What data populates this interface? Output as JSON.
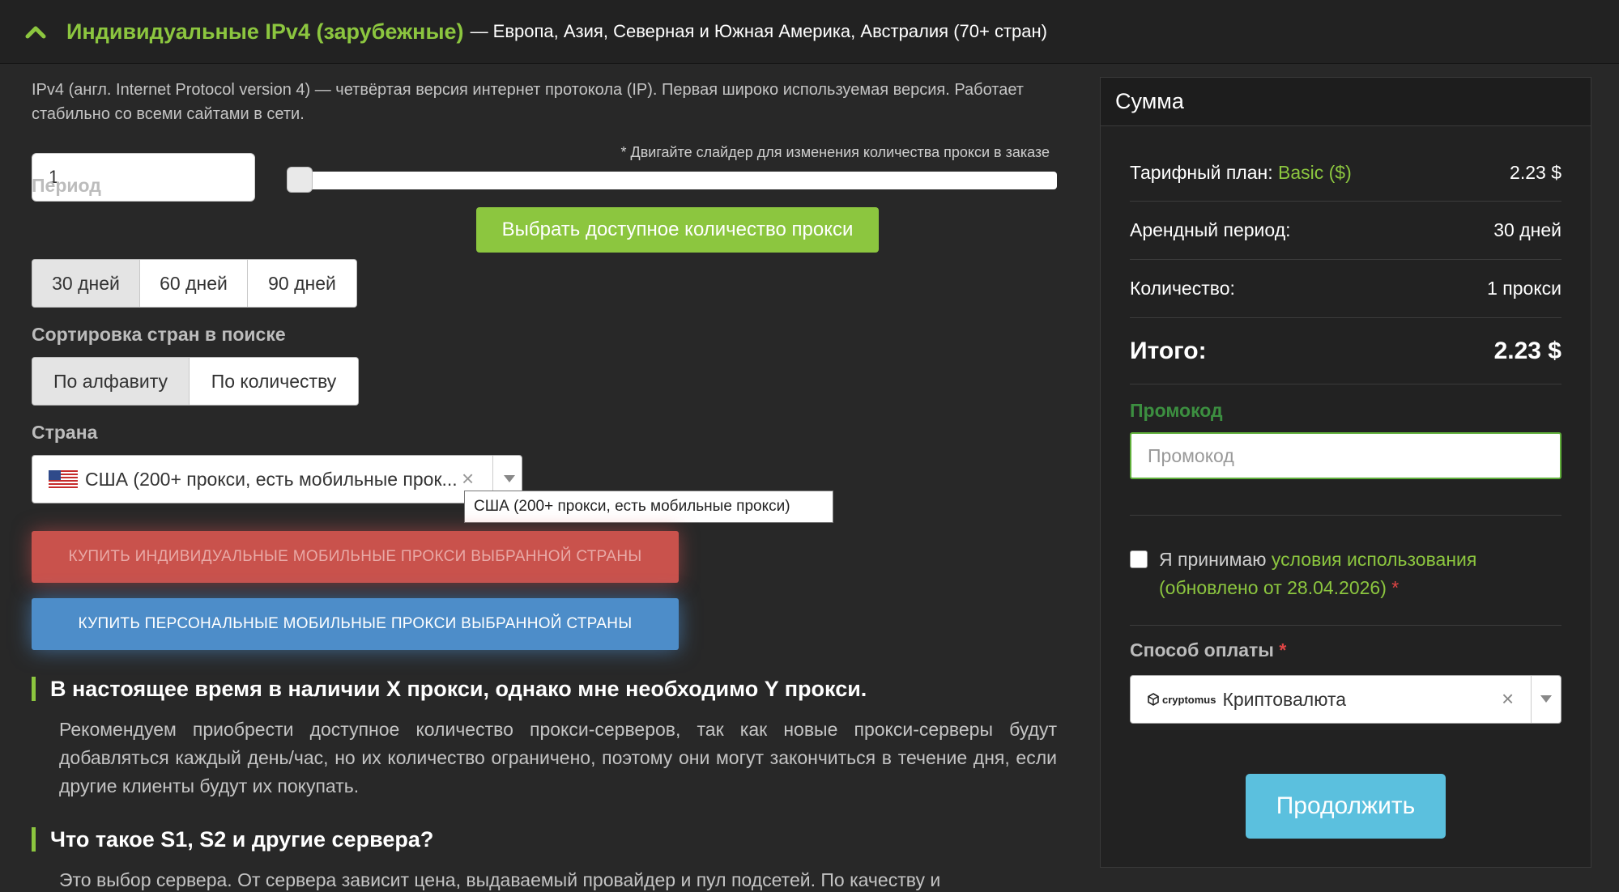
{
  "header": {
    "title": "Индивидуальные IPv4 (зарубежные)",
    "subtitle": "— Европа, Азия, Северная и Южная Америка, Австралия (70+ стран)",
    "collapse_icon": "chevron-up-icon"
  },
  "intro": {
    "text": "IPv4 (англ. Internet Protocol version 4) — четвёртая версия интернет протокола (IP). Первая широко используемая версия. Работает стабильно со всеми сайтами в сети."
  },
  "quantity": {
    "value": "1",
    "slider_hint": "* Двигайте слайдер для изменения количества прокси в заказе",
    "slider_level": 0,
    "available_button": "Выбрать доступное количество прокси"
  },
  "period": {
    "label": "Период",
    "options": [
      "30 дней",
      "60 дней",
      "90 дней"
    ],
    "selected": "30 дней"
  },
  "sort": {
    "label": "Сортировка стран в поиске",
    "options": [
      "По алфавиту",
      "По количеству"
    ],
    "selected": "По алфавиту"
  },
  "country": {
    "label": "Страна",
    "value": "США (200+ прокси, есть мобильные прок...",
    "tooltip": "США (200+ прокси, есть мобильные прокси)",
    "flag_icon": "us-flag-icon"
  },
  "buttons": {
    "buy_individual_mobile": "КУПИТЬ ИНДИВИДУАЛЬНЫЕ МОБИЛЬНЫЕ ПРОКСИ ВЫБРАННОЙ СТРАНЫ",
    "buy_personal_mobile": "КУПИТЬ ПЕРСОНАЛЬНЫЕ МОБИЛЬНЫЕ ПРОКСИ ВЫБРАННОЙ СТРАНЫ"
  },
  "faq": [
    {
      "question": "В настоящее время в наличии X прокси, однако мне необходимо Y прокси.",
      "answer": "Рекомендуем приобрести доступное количество прокси-серверов, так как новые прокси-серверы будут добавляться каждый день/час, но их количество ограничено, поэтому они могут закончиться в течение дня, если другие клиенты будут их покупать."
    },
    {
      "question": "Что такое S1, S2 и другие сервера?",
      "answer": "Это выбор сервера. От сервера зависит цена, выдаваемый провайдер и пул подсетей. По качеству и"
    }
  ],
  "summary": {
    "title": "Сумма",
    "plan_label": "Тарифный план:",
    "plan_name": "Basic ($)",
    "plan_price": "2.23 $",
    "period_label": "Арендный период:",
    "period_value": "30 дней",
    "quantity_label": "Количество:",
    "quantity_value": "1 прокси",
    "total_label": "Итого:",
    "total_value": "2.23 $",
    "promo_label": "Промокод",
    "promo_placeholder": "Промокод",
    "terms_prefix": "Я принимаю",
    "terms_link": "условия использования (обновлено от 28.04.2026)",
    "terms_required": "*",
    "payment_label": "Способ оплаты",
    "payment_required": "*",
    "payment_logo": "cryptomus",
    "payment_value": "Криптовалюта",
    "continue_button": "Продолжить"
  },
  "colors": {
    "accent_green": "#8cc63f",
    "danger_red": "#c9524c",
    "primary_blue": "#4d8dc9",
    "info_cyan": "#5bc0de",
    "background": "#282828"
  }
}
